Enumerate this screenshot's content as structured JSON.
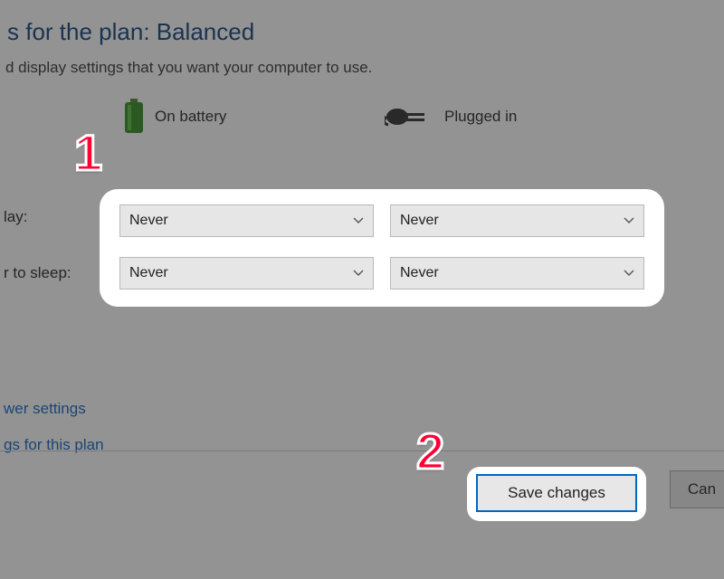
{
  "header": {
    "title_fragment": "s for the plan: Balanced",
    "subtitle_fragment": "d display settings that you want your computer to use."
  },
  "columns": {
    "battery_label": "On battery",
    "plugged_label": "Plugged in"
  },
  "rows": {
    "display_label_fragment": "lay:",
    "sleep_label_fragment": "r to sleep:"
  },
  "dropdowns": {
    "display_battery": "Never",
    "display_plugged": "Never",
    "sleep_battery": "Never",
    "sleep_plugged": "Never"
  },
  "links": {
    "power_settings_fragment": "wer settings",
    "restore_fragment": "gs for this plan"
  },
  "buttons": {
    "save": "Save changes",
    "cancel_fragment": "Can"
  },
  "annotations": {
    "one": "1",
    "two": "2"
  }
}
